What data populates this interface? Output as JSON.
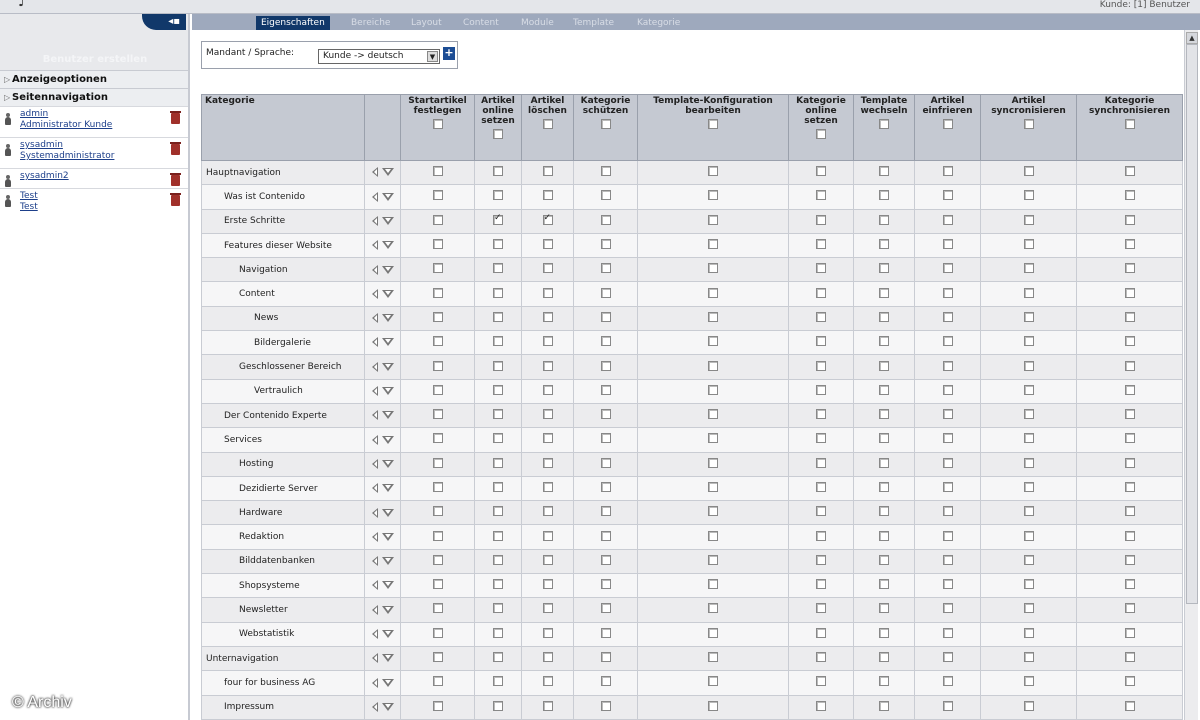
{
  "header": {
    "user_info": "Kunde: [1]   Benutzer"
  },
  "left": {
    "create_user_label": "Benutzer erstellen",
    "sections": [
      {
        "label": "Anzeigeoptionen"
      },
      {
        "label": "Seitennavigation"
      }
    ],
    "users": [
      {
        "name": "admin",
        "role": "Administrator Kunde"
      },
      {
        "name": "sysadmin",
        "role": "Systemadministrator"
      },
      {
        "name": "sysadmin2",
        "role": ""
      },
      {
        "name": "Test",
        "role": "Test"
      }
    ]
  },
  "tabs": [
    "Eigenschaften",
    "Bereiche",
    "Layout",
    "Content",
    "Module",
    "Template",
    "Kategorie"
  ],
  "filter": {
    "label": "Mandant / Sprache:",
    "selected": "Kunde -> deutsch"
  },
  "table": {
    "columns": [
      "Kategorie",
      "Startartikel festlegen",
      "Artikel online setzen",
      "Artikel löschen",
      "Kategorie schützen",
      "Template-Konfiguration bearbeiten",
      "Kategorie online setzen",
      "Template wechseln",
      "Artikel einfrieren",
      "Artikel syncronisieren",
      "Kategorie synchronisieren"
    ],
    "rows": [
      {
        "name": "Hauptnavigation",
        "level": 0,
        "checks": [
          0,
          0,
          0,
          0,
          0,
          0,
          0,
          0,
          0,
          0
        ]
      },
      {
        "name": "Was ist Contenido",
        "level": 1,
        "checks": [
          0,
          0,
          0,
          0,
          0,
          0,
          0,
          0,
          0,
          0
        ]
      },
      {
        "name": "Erste Schritte",
        "level": 1,
        "checks": [
          0,
          1,
          1,
          0,
          0,
          0,
          0,
          0,
          0,
          0
        ]
      },
      {
        "name": "Features dieser Website",
        "level": 1,
        "checks": [
          0,
          0,
          0,
          0,
          0,
          0,
          0,
          0,
          0,
          0
        ]
      },
      {
        "name": "Navigation",
        "level": 2,
        "checks": [
          0,
          0,
          0,
          0,
          0,
          0,
          0,
          0,
          0,
          0
        ]
      },
      {
        "name": "Content",
        "level": 2,
        "checks": [
          0,
          0,
          0,
          0,
          0,
          0,
          0,
          0,
          0,
          0
        ]
      },
      {
        "name": "News",
        "level": 3,
        "checks": [
          0,
          0,
          0,
          0,
          0,
          0,
          0,
          0,
          0,
          0
        ]
      },
      {
        "name": "Bildergalerie",
        "level": 3,
        "checks": [
          0,
          0,
          0,
          0,
          0,
          0,
          0,
          0,
          0,
          0
        ]
      },
      {
        "name": "Geschlossener Bereich",
        "level": 2,
        "checks": [
          0,
          0,
          0,
          0,
          0,
          0,
          0,
          0,
          0,
          0
        ]
      },
      {
        "name": "Vertraulich",
        "level": 3,
        "checks": [
          0,
          0,
          0,
          0,
          0,
          0,
          0,
          0,
          0,
          0
        ]
      },
      {
        "name": "Der Contenido Experte",
        "level": 1,
        "checks": [
          0,
          0,
          0,
          0,
          0,
          0,
          0,
          0,
          0,
          0
        ]
      },
      {
        "name": "Services",
        "level": 1,
        "checks": [
          0,
          0,
          0,
          0,
          0,
          0,
          0,
          0,
          0,
          0
        ]
      },
      {
        "name": "Hosting",
        "level": 2,
        "checks": [
          0,
          0,
          0,
          0,
          0,
          0,
          0,
          0,
          0,
          0
        ]
      },
      {
        "name": "Dezidierte Server",
        "level": 2,
        "checks": [
          0,
          0,
          0,
          0,
          0,
          0,
          0,
          0,
          0,
          0
        ]
      },
      {
        "name": "Hardware",
        "level": 2,
        "checks": [
          0,
          0,
          0,
          0,
          0,
          0,
          0,
          0,
          0,
          0
        ]
      },
      {
        "name": "Redaktion",
        "level": 2,
        "checks": [
          0,
          0,
          0,
          0,
          0,
          0,
          0,
          0,
          0,
          0
        ]
      },
      {
        "name": "Bilddatenbanken",
        "level": 2,
        "checks": [
          0,
          0,
          0,
          0,
          0,
          0,
          0,
          0,
          0,
          0
        ]
      },
      {
        "name": "Shopsysteme",
        "level": 2,
        "checks": [
          0,
          0,
          0,
          0,
          0,
          0,
          0,
          0,
          0,
          0
        ]
      },
      {
        "name": "Newsletter",
        "level": 2,
        "checks": [
          0,
          0,
          0,
          0,
          0,
          0,
          0,
          0,
          0,
          0
        ]
      },
      {
        "name": "Webstatistik",
        "level": 2,
        "checks": [
          0,
          0,
          0,
          0,
          0,
          0,
          0,
          0,
          0,
          0
        ]
      },
      {
        "name": "Unternavigation",
        "level": 0,
        "checks": [
          0,
          0,
          0,
          0,
          0,
          0,
          0,
          0,
          0,
          0
        ]
      },
      {
        "name": "four for business AG",
        "level": 1,
        "checks": [
          0,
          0,
          0,
          0,
          0,
          0,
          0,
          0,
          0,
          0
        ]
      },
      {
        "name": "Impressum",
        "level": 1,
        "checks": [
          0,
          0,
          0,
          0,
          0,
          0,
          0,
          0,
          0,
          0
        ]
      }
    ]
  },
  "watermark": "© Archiv"
}
